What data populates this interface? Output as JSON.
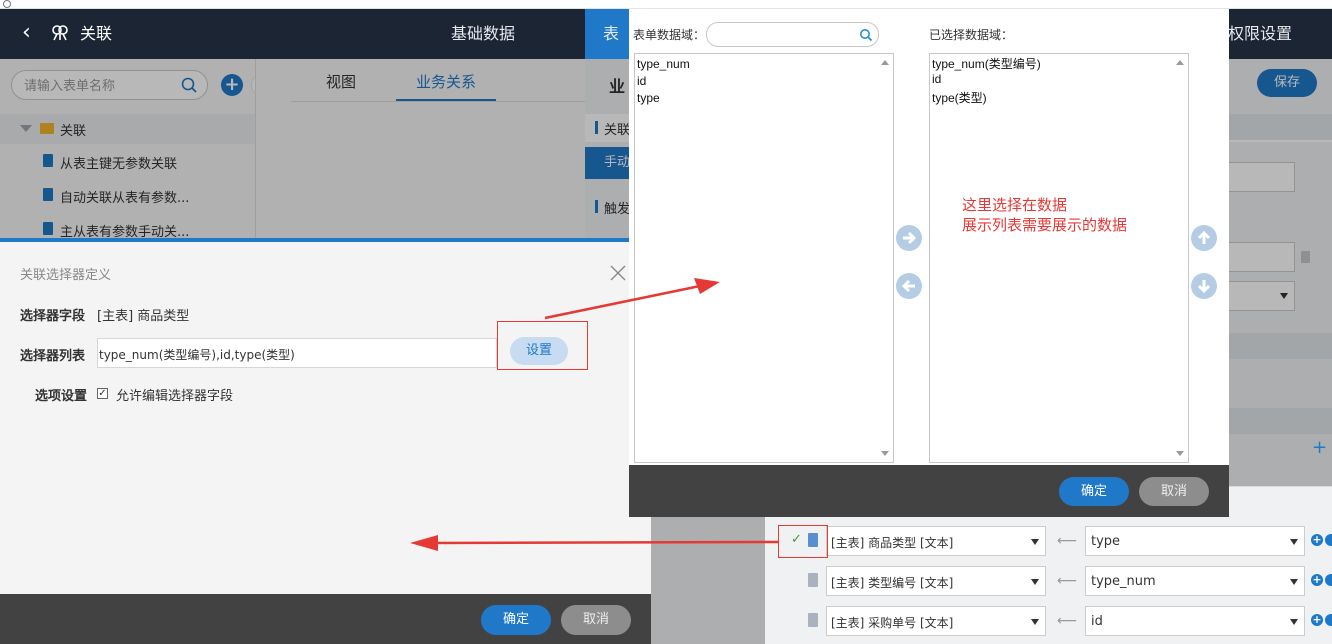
{
  "header": {
    "app_title": "关联",
    "nav": [
      "基础数据",
      "表单",
      "权限设置"
    ]
  },
  "sidebar": {
    "search_placeholder": "请输入表单名称",
    "folder": "关联",
    "items": [
      "从表主键无参数关联",
      "自动关联从表有参数...",
      "主从表有参数手动关..."
    ]
  },
  "mid": {
    "tabs": [
      "视图",
      "业务关系"
    ]
  },
  "right": {
    "title": "业",
    "section1": "关联",
    "manual_tab": "手动",
    "section2": "触发",
    "save_label": "保存",
    "mappings": [
      {
        "field": "[主表] 商品类型 [文本]",
        "target": "type",
        "checked": true
      },
      {
        "field": "[主表] 类型编号 [文本]",
        "target": "type_num",
        "checked": false
      },
      {
        "field": "[主表] 采购单号 [文本]",
        "target": "id",
        "checked": false
      }
    ]
  },
  "modal1": {
    "title": "关联选择器定义",
    "field_label": "选择器字段",
    "field_value": "[主表] 商品类型",
    "list_label": "选择器列表",
    "list_value": "type_num(类型编号),id,type(类型)",
    "set_label": "设置",
    "option_label": "选项设置",
    "option_text": "允许编辑选择器字段",
    "ok": "确定",
    "cancel": "取消"
  },
  "modal2": {
    "left_label": "表单数据域：",
    "right_label": "已选择数据域：",
    "left_items": [
      "type_num",
      "id",
      "type"
    ],
    "right_items": [
      "type_num(类型编号)",
      "id",
      "type(类型)"
    ],
    "note_line1": "这里选择在数据",
    "note_line2": "展示列表需要展示的数据",
    "ok": "确定",
    "cancel": "取消"
  },
  "colors": {
    "primary": "#1f79c8",
    "header_bg": "#1b2533",
    "annotation": "#e53935"
  }
}
